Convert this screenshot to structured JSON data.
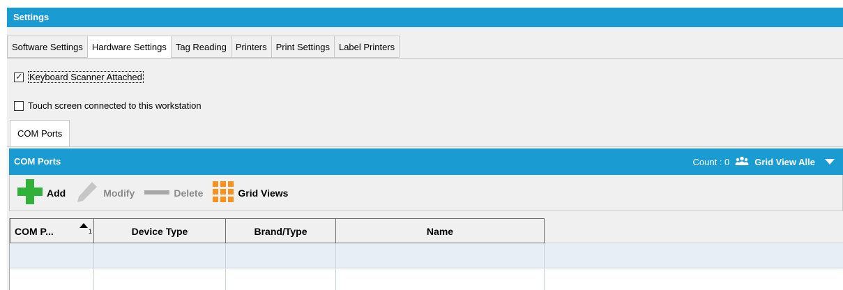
{
  "window": {
    "title": "Settings"
  },
  "tabs": [
    {
      "label": "Software Settings",
      "active": false
    },
    {
      "label": "Hardware Settings",
      "active": true
    },
    {
      "label": "Tag Reading",
      "active": false
    },
    {
      "label": "Printers",
      "active": false
    },
    {
      "label": "Print Settings",
      "active": false
    },
    {
      "label": "Label Printers",
      "active": false
    }
  ],
  "checkboxes": {
    "keyboard_scanner": {
      "label": "Keyboard Scanner Attached",
      "checked": true
    },
    "touch_screen": {
      "label": "Touch screen connected to this workstation",
      "checked": false
    }
  },
  "subtab": {
    "label": "COM Ports"
  },
  "panel": {
    "title": "COM Ports",
    "count_text": "Count : 0",
    "grid_view_label": "Grid View Alle",
    "people_icon": "people-group-icon",
    "dropdown_icon": "caret-down-icon"
  },
  "toolbar": {
    "add_label": "Add",
    "modify_label": "Modify",
    "delete_label": "Delete",
    "grid_views_label": "Grid Views"
  },
  "grid": {
    "columns": [
      "COM P...",
      "Device Type",
      "Brand/Type",
      "Name"
    ],
    "sort_index": "1",
    "rows": [
      [
        "",
        "",
        "",
        ""
      ],
      [
        "",
        "",
        "",
        ""
      ]
    ]
  },
  "colors": {
    "accent": "#1a9bd1",
    "add_green": "#2fb13a",
    "grid_views_orange": "#f7931d",
    "disabled_gray": "#8a8a8a"
  }
}
